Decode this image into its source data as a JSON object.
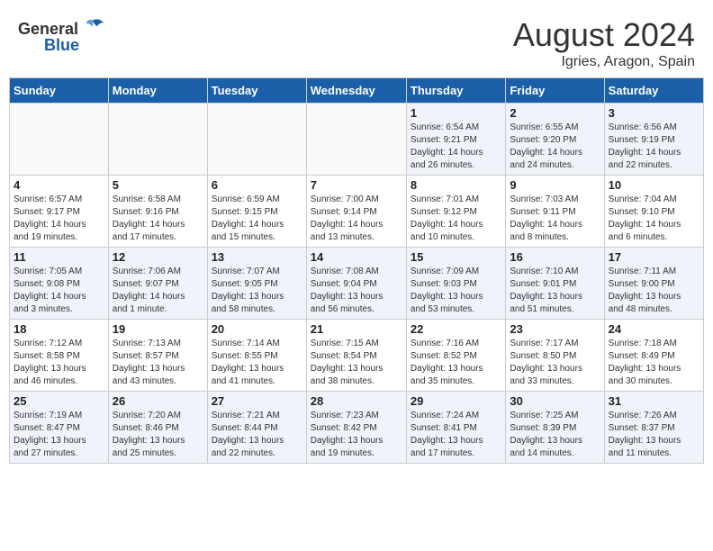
{
  "header": {
    "logo_general": "General",
    "logo_blue": "Blue",
    "month_year": "August 2024",
    "location": "Igries, Aragon, Spain"
  },
  "days_of_week": [
    "Sunday",
    "Monday",
    "Tuesday",
    "Wednesday",
    "Thursday",
    "Friday",
    "Saturday"
  ],
  "weeks": [
    [
      {
        "day": "",
        "info": ""
      },
      {
        "day": "",
        "info": ""
      },
      {
        "day": "",
        "info": ""
      },
      {
        "day": "",
        "info": ""
      },
      {
        "day": "1",
        "info": "Sunrise: 6:54 AM\nSunset: 9:21 PM\nDaylight: 14 hours\nand 26 minutes."
      },
      {
        "day": "2",
        "info": "Sunrise: 6:55 AM\nSunset: 9:20 PM\nDaylight: 14 hours\nand 24 minutes."
      },
      {
        "day": "3",
        "info": "Sunrise: 6:56 AM\nSunset: 9:19 PM\nDaylight: 14 hours\nand 22 minutes."
      }
    ],
    [
      {
        "day": "4",
        "info": "Sunrise: 6:57 AM\nSunset: 9:17 PM\nDaylight: 14 hours\nand 19 minutes."
      },
      {
        "day": "5",
        "info": "Sunrise: 6:58 AM\nSunset: 9:16 PM\nDaylight: 14 hours\nand 17 minutes."
      },
      {
        "day": "6",
        "info": "Sunrise: 6:59 AM\nSunset: 9:15 PM\nDaylight: 14 hours\nand 15 minutes."
      },
      {
        "day": "7",
        "info": "Sunrise: 7:00 AM\nSunset: 9:14 PM\nDaylight: 14 hours\nand 13 minutes."
      },
      {
        "day": "8",
        "info": "Sunrise: 7:01 AM\nSunset: 9:12 PM\nDaylight: 14 hours\nand 10 minutes."
      },
      {
        "day": "9",
        "info": "Sunrise: 7:03 AM\nSunset: 9:11 PM\nDaylight: 14 hours\nand 8 minutes."
      },
      {
        "day": "10",
        "info": "Sunrise: 7:04 AM\nSunset: 9:10 PM\nDaylight: 14 hours\nand 6 minutes."
      }
    ],
    [
      {
        "day": "11",
        "info": "Sunrise: 7:05 AM\nSunset: 9:08 PM\nDaylight: 14 hours\nand 3 minutes."
      },
      {
        "day": "12",
        "info": "Sunrise: 7:06 AM\nSunset: 9:07 PM\nDaylight: 14 hours\nand 1 minute."
      },
      {
        "day": "13",
        "info": "Sunrise: 7:07 AM\nSunset: 9:05 PM\nDaylight: 13 hours\nand 58 minutes."
      },
      {
        "day": "14",
        "info": "Sunrise: 7:08 AM\nSunset: 9:04 PM\nDaylight: 13 hours\nand 56 minutes."
      },
      {
        "day": "15",
        "info": "Sunrise: 7:09 AM\nSunset: 9:03 PM\nDaylight: 13 hours\nand 53 minutes."
      },
      {
        "day": "16",
        "info": "Sunrise: 7:10 AM\nSunset: 9:01 PM\nDaylight: 13 hours\nand 51 minutes."
      },
      {
        "day": "17",
        "info": "Sunrise: 7:11 AM\nSunset: 9:00 PM\nDaylight: 13 hours\nand 48 minutes."
      }
    ],
    [
      {
        "day": "18",
        "info": "Sunrise: 7:12 AM\nSunset: 8:58 PM\nDaylight: 13 hours\nand 46 minutes."
      },
      {
        "day": "19",
        "info": "Sunrise: 7:13 AM\nSunset: 8:57 PM\nDaylight: 13 hours\nand 43 minutes."
      },
      {
        "day": "20",
        "info": "Sunrise: 7:14 AM\nSunset: 8:55 PM\nDaylight: 13 hours\nand 41 minutes."
      },
      {
        "day": "21",
        "info": "Sunrise: 7:15 AM\nSunset: 8:54 PM\nDaylight: 13 hours\nand 38 minutes."
      },
      {
        "day": "22",
        "info": "Sunrise: 7:16 AM\nSunset: 8:52 PM\nDaylight: 13 hours\nand 35 minutes."
      },
      {
        "day": "23",
        "info": "Sunrise: 7:17 AM\nSunset: 8:50 PM\nDaylight: 13 hours\nand 33 minutes."
      },
      {
        "day": "24",
        "info": "Sunrise: 7:18 AM\nSunset: 8:49 PM\nDaylight: 13 hours\nand 30 minutes."
      }
    ],
    [
      {
        "day": "25",
        "info": "Sunrise: 7:19 AM\nSunset: 8:47 PM\nDaylight: 13 hours\nand 27 minutes."
      },
      {
        "day": "26",
        "info": "Sunrise: 7:20 AM\nSunset: 8:46 PM\nDaylight: 13 hours\nand 25 minutes."
      },
      {
        "day": "27",
        "info": "Sunrise: 7:21 AM\nSunset: 8:44 PM\nDaylight: 13 hours\nand 22 minutes."
      },
      {
        "day": "28",
        "info": "Sunrise: 7:23 AM\nSunset: 8:42 PM\nDaylight: 13 hours\nand 19 minutes."
      },
      {
        "day": "29",
        "info": "Sunrise: 7:24 AM\nSunset: 8:41 PM\nDaylight: 13 hours\nand 17 minutes."
      },
      {
        "day": "30",
        "info": "Sunrise: 7:25 AM\nSunset: 8:39 PM\nDaylight: 13 hours\nand 14 minutes."
      },
      {
        "day": "31",
        "info": "Sunrise: 7:26 AM\nSunset: 8:37 PM\nDaylight: 13 hours\nand 11 minutes."
      }
    ]
  ]
}
